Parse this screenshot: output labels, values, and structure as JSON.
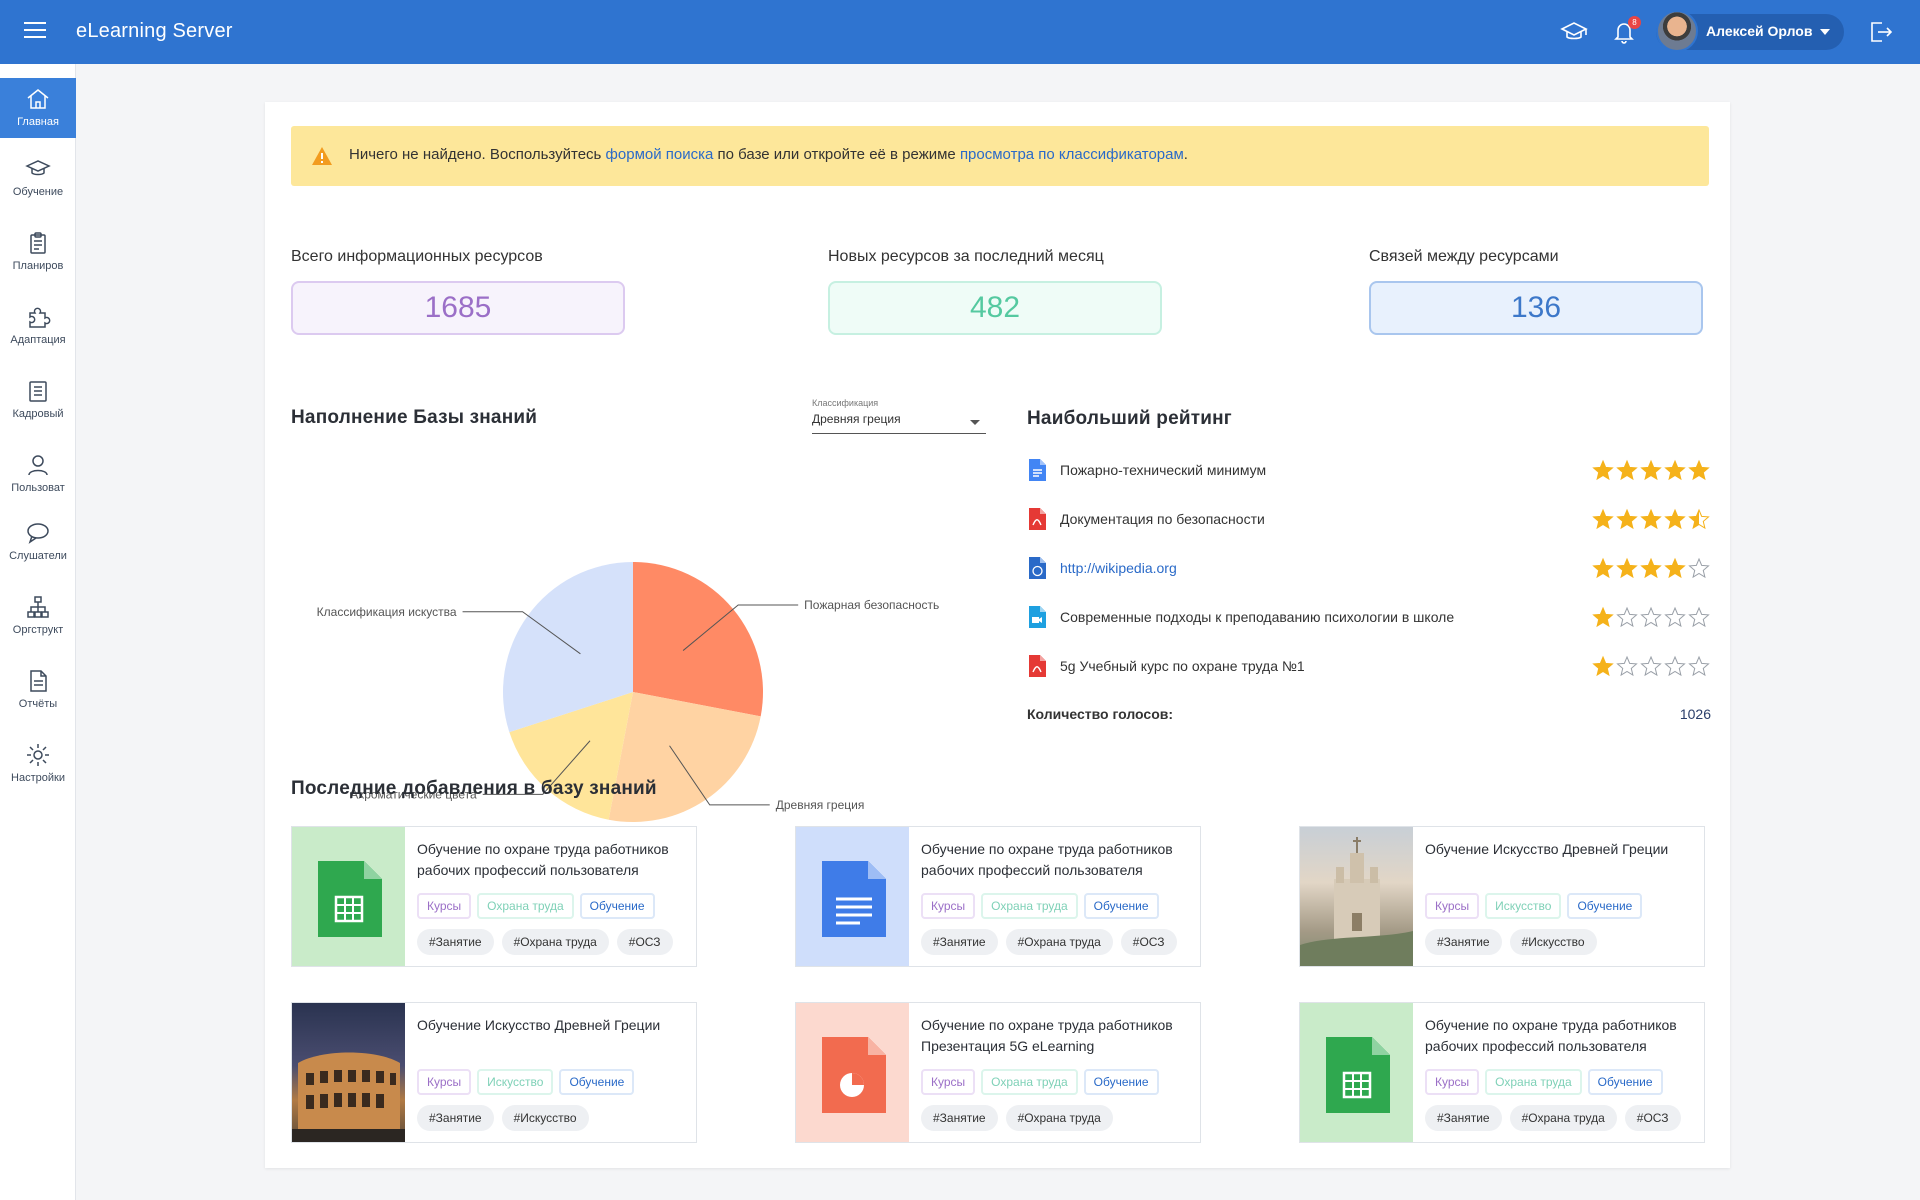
{
  "header": {
    "app_title": "eLearning Server",
    "user_name": "Алексей Орлов",
    "notification_count": "8",
    "icons": [
      "menu-icon",
      "graduation-cap-icon",
      "bell-icon",
      "logout-icon"
    ]
  },
  "sidebar": {
    "items": [
      {
        "label": "Главная",
        "icon": "home-icon",
        "active": true
      },
      {
        "label": "Обучение",
        "icon": "graduation-cap-icon"
      },
      {
        "label": "Планиров",
        "icon": "clipboard-icon"
      },
      {
        "label": "Адаптация",
        "icon": "puzzle-icon"
      },
      {
        "label": "Кадровый",
        "icon": "document-icon"
      },
      {
        "label": "Пользоват",
        "icon": "user-icon"
      },
      {
        "label": "Слушатели",
        "icon": "chat-icon"
      },
      {
        "label": "Оргструкт",
        "icon": "org-chart-icon"
      },
      {
        "label": "Отчёты",
        "icon": "report-icon"
      },
      {
        "label": "Настройки",
        "icon": "gear-icon"
      }
    ]
  },
  "alert": {
    "text_before": "Ничего не найдено. Воспользуйтесь ",
    "link1": "формой поиска",
    "text_middle": " по базе или откройте её в режиме ",
    "link2": "просмотра по классификаторам",
    "text_after": "."
  },
  "stats": [
    {
      "label": "Всего информационных ресурсов",
      "value": "1685",
      "color": "#9b6fc7",
      "bg": "#f7f3fc",
      "border": "#dccaf0"
    },
    {
      "label": "Новых ресурсов за последний месяц",
      "value": "482",
      "color": "#55c9a0",
      "bg": "#effcf7",
      "border": "#c6f0e1"
    },
    {
      "label": "Связей между ресурсами",
      "value": "136",
      "color": "#3d78c9",
      "bg": "#e8f1fd",
      "border": "#a9c6ee"
    }
  ],
  "knowledge": {
    "title": "Наполнение Базы знаний",
    "select_caption": "Классификация",
    "select_value": "Древняя греция"
  },
  "chart_data": {
    "type": "pie",
    "slices": [
      {
        "label": "Пожарная безопасность",
        "value": 28,
        "color": "#ff8a65"
      },
      {
        "label": "Древняя греция",
        "value": 25,
        "color": "#ffd3a3"
      },
      {
        "label": "Ахроматические цвета",
        "value": 17,
        "color": "#ffe59a"
      },
      {
        "label": "Классификация искуства",
        "value": 30,
        "color": "#d5e1fa"
      }
    ]
  },
  "rating": {
    "title": "Наибольший рейтинг",
    "items": [
      {
        "name": "Пожарно-технический минимум",
        "icon": "google-doc-icon",
        "rating": 5
      },
      {
        "name": "Документация по безопасности",
        "icon": "pdf-icon",
        "rating": 4.5
      },
      {
        "name": "http://wikipedia.org",
        "icon": "web-link-icon",
        "rating": 4
      },
      {
        "name": "Современные подходы к преподаванию психологии в школе",
        "icon": "video-icon",
        "rating": 1
      },
      {
        "name": "5g Учебный курс по охране труда №1",
        "icon": "pdf-icon",
        "rating": 1
      }
    ],
    "votes_label": "Количество голосов:",
    "votes_value": "1026"
  },
  "recent": {
    "title": "Последние добавления в базу знаний",
    "cards": [
      {
        "title": "Обучение по охране труда работников рабочих профессий пользователя",
        "thumb": "spreadsheet-icon",
        "chips": [
          "Курсы",
          "Охрана труда",
          "Обучение"
        ],
        "tags": [
          "#Занятие",
          "#Охрана труда",
          "#ОСЗ"
        ]
      },
      {
        "title": "Обучение по охране труда работников рабочих профессий пользователя",
        "thumb": "document-icon",
        "chips": [
          "Курсы",
          "Охрана труда",
          "Обучение"
        ],
        "tags": [
          "#Занятие",
          "#Охрана труда",
          "#ОСЗ"
        ]
      },
      {
        "title": "Обучение Искусство Древней Греции",
        "thumb": "cathedral-photo",
        "chips": [
          "Курсы",
          "Искусство",
          "Обучение"
        ],
        "tags": [
          "#Занятие",
          "#Искусство"
        ]
      },
      {
        "title": "Обучение Искусство Древней Греции",
        "thumb": "colosseum-photo",
        "chips": [
          "Курсы",
          "Искусство",
          "Обучение"
        ],
        "tags": [
          "#Занятие",
          "#Искусство"
        ]
      },
      {
        "title": "Обучение по охране труда работников Презентация 5G eLearning",
        "thumb": "presentation-icon",
        "chips": [
          "Курсы",
          "Охрана труда",
          "Обучение"
        ],
        "tags": [
          "#Занятие",
          "#Охрана труда"
        ]
      },
      {
        "title": "Обучение по охране труда работников рабочих профессий пользователя",
        "thumb": "spreadsheet-icon",
        "chips": [
          "Курсы",
          "Охрана труда",
          "Обучение"
        ],
        "tags": [
          "#Занятие",
          "#Охрана труда",
          "#ОСЗ"
        ]
      }
    ]
  }
}
